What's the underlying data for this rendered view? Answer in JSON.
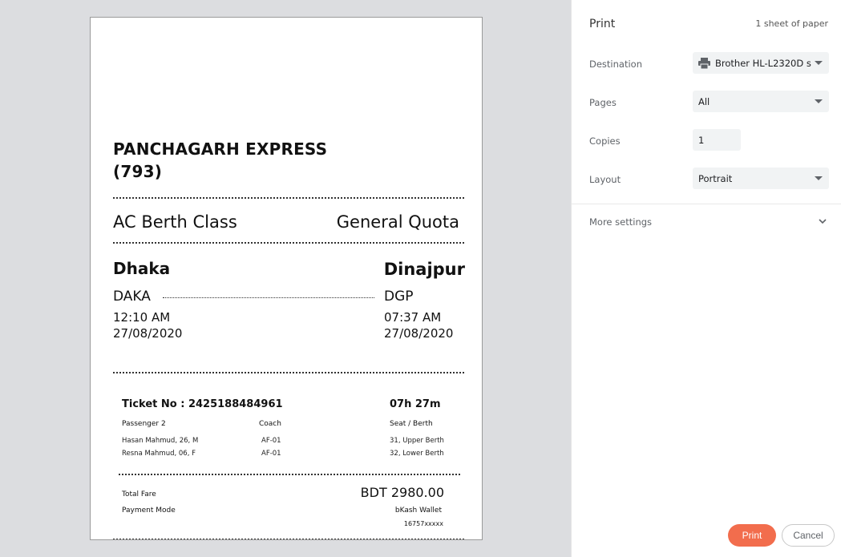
{
  "ticket": {
    "train_name": "PANCHAGARH EXPRESS (793)",
    "class": "AC Berth Class",
    "quota": "General Quota",
    "from": {
      "city": "Dhaka",
      "code": "DAKA",
      "time": "12:10 AM",
      "date": "27/08/2020"
    },
    "to": {
      "city": "Dinajpur",
      "code": "DGP",
      "time": "07:37 AM",
      "date": "27/08/2020"
    },
    "ticket_no": "Ticket No : 2425188484961",
    "duration": "07h 27m",
    "headers": {
      "passenger": "Passenger 2",
      "coach": "Coach",
      "seat": "Seat / Berth"
    },
    "passengers": [
      {
        "name": "Hasan Mahmud, 26, M",
        "coach": "AF-01",
        "seat": "31, Upper Berth"
      },
      {
        "name": "Resna Mahmud, 06, F",
        "coach": "AF-01",
        "seat": "32, Lower Berth"
      }
    ],
    "total_fare_label": "Total Fare",
    "total_fare": "BDT 2980.00",
    "payment_mode_label": "Payment Mode",
    "payment_mode": "bKash Wallet",
    "payment_account": "16757xxxxx"
  },
  "panel": {
    "title": "Print",
    "sheets": "1 sheet of paper",
    "destination_label": "Destination",
    "destination_value": "Brother HL-L2320D s",
    "pages_label": "Pages",
    "pages_value": "All",
    "copies_label": "Copies",
    "copies_value": "1",
    "layout_label": "Layout",
    "layout_value": "Portrait",
    "more_settings": "More settings",
    "print_button": "Print",
    "cancel_button": "Cancel",
    "accent_color": "#f26d4d"
  }
}
